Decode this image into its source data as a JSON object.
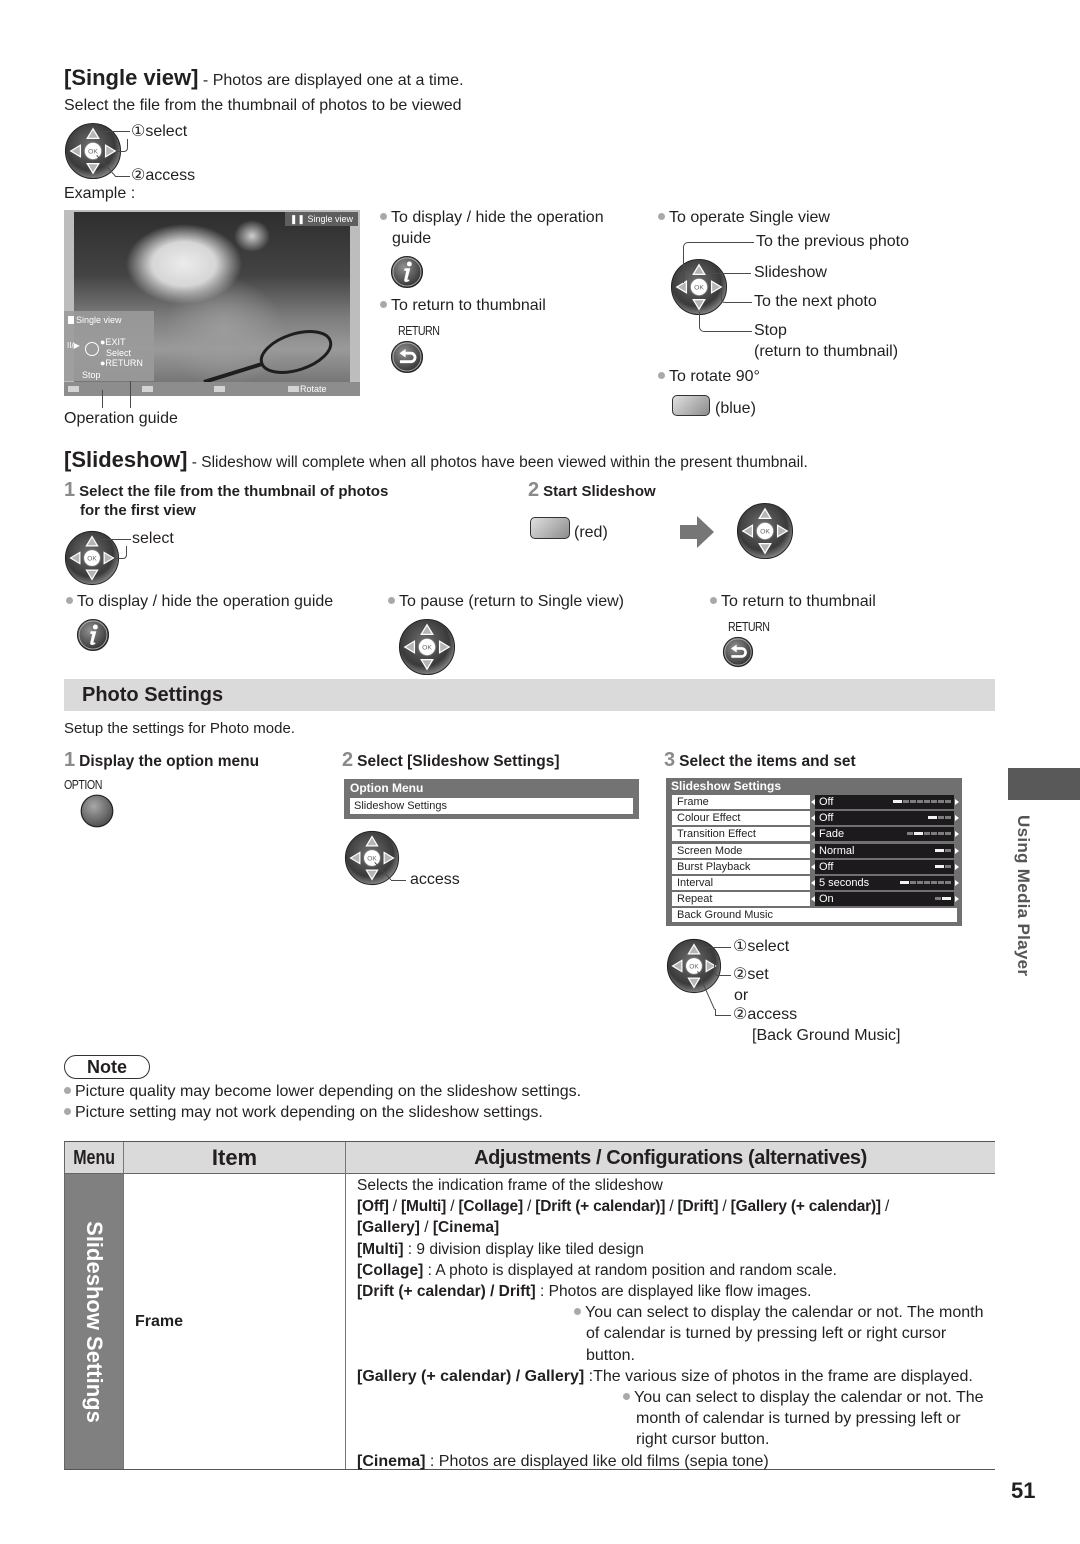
{
  "remote": {
    "ok_label": "OK"
  },
  "single_view": {
    "title": "[Single view]",
    "subtitle": " - Photos are displayed one at a time.",
    "instruction": "Select the file from the thumbnail of photos to be viewed",
    "select_label": "①select",
    "access_label": "②access",
    "example_label": "Example :",
    "screen": {
      "badge": "Single view",
      "guide_title": "Single view",
      "guide_play_pause": "II/▶",
      "guide_exit": "●EXIT",
      "guide_select": "Select",
      "guide_return": "●RETURN",
      "guide_stop": "Stop",
      "rotate": "Rotate"
    },
    "operation_guide_label": "Operation guide",
    "display_hide_line1": "To display / hide the operation",
    "display_hide_line2": "guide",
    "return_to_thumbnail": "To return to thumbnail",
    "return_button_caption": "RETURN",
    "operate": {
      "title": "To operate Single view",
      "previous": "To the previous photo",
      "slideshow": "Slideshow",
      "next": "To the next photo",
      "stop": "Stop",
      "stop_note": "(return to thumbnail)"
    },
    "rotate": {
      "title": "To rotate 90°",
      "button_caption": "(blue)"
    }
  },
  "slideshow": {
    "title": "[Slideshow]",
    "subtitle": " - Slideshow will complete when all photos have been viewed within the present thumbnail.",
    "step1": {
      "number": "1",
      "title_line1": "Select the file from the thumbnail of photos",
      "title_line2": "for the first view",
      "select_label": "select"
    },
    "step2": {
      "number": "2",
      "title": "Start Slideshow",
      "button_caption": "(red)"
    },
    "display_hide": "To display / hide the operation guide",
    "pause": "To pause (return to Single view)",
    "return_to_thumbnail": "To return to thumbnail",
    "return_button_caption": "RETURN"
  },
  "photo_settings": {
    "heading": "Photo Settings",
    "intro": "Setup the settings for Photo mode.",
    "step1": {
      "number": "1",
      "title": "Display the option menu",
      "button_caption": "OPTION"
    },
    "step2": {
      "number": "2",
      "title": "Select [Slideshow Settings]",
      "menu_title": "Option Menu",
      "menu_item": "Slideshow Settings",
      "access_label": "access"
    },
    "step3": {
      "number": "3",
      "title": "Select the items and set",
      "panel_title": "Slideshow Settings",
      "rows": [
        {
          "label": "Frame",
          "value": "Off",
          "options_count": 8,
          "selected_index": 0
        },
        {
          "label": "Colour Effect",
          "value": "Off",
          "options_count": 3,
          "selected_index": 0
        },
        {
          "label": "Transition Effect",
          "value": "Fade",
          "options_count": 6,
          "selected_index": 1
        },
        {
          "label": "Screen Mode",
          "value": "Normal",
          "options_count": 2,
          "selected_index": 0
        },
        {
          "label": "Burst Playback",
          "value": "Off",
          "options_count": 2,
          "selected_index": 0
        },
        {
          "label": "Interval",
          "value": "5 seconds",
          "options_count": 7,
          "selected_index": 0
        },
        {
          "label": "Repeat",
          "value": "On",
          "options_count": 2,
          "selected_index": 1
        },
        {
          "label": "Back Ground Music"
        }
      ],
      "select_label": "①select",
      "set_label": "②set",
      "or_label": "or",
      "access_label": "②access",
      "access_target": "[Back Ground Music]"
    }
  },
  "side_tab": {
    "label": "Using Media Player"
  },
  "note": {
    "title": "Note",
    "items": [
      "Picture quality may become lower depending on the slideshow settings.",
      "Picture setting may not work depending on the slideshow settings."
    ]
  },
  "table": {
    "headers": {
      "menu": "Menu",
      "item": "Item",
      "adjustments": "Adjustments / Configurations (alternatives)"
    },
    "menu_group": "Slideshow Settings",
    "rows": [
      {
        "item": "Frame",
        "intro": "Selects the indication frame of the slideshow",
        "separator": " / ",
        "options": [
          "[Off]",
          "[Multi]",
          "[Collage]",
          "[Drift (+ calendar)]",
          "[Drift]",
          "[Gallery (+ calendar)]",
          "[Gallery]",
          "[Cinema]"
        ],
        "descriptions": [
          {
            "term": "[Multi]",
            "text": " : 9 division display like tiled design"
          },
          {
            "term": "[Collage]",
            "text": " : A photo is displayed at random position and random scale."
          },
          {
            "term": "[Drift (+ calendar) / Drift]",
            "text": " :  Photos are displayed like flow images.",
            "note_lines": [
              "You can select to display the calendar or not. The month",
              "of calendar is turned by pressing left or right cursor",
              "button."
            ]
          },
          {
            "term": "[Gallery (+ calendar) / Gallery]",
            "text": " :The various size of photos in the frame are displayed.",
            "note_lines": [
              "You can select to display the calendar or not. The",
              "month of calendar is turned by pressing left or",
              "right cursor button."
            ]
          },
          {
            "term": "[Cinema]",
            "text": " : Photos are displayed like old films (sepia tone)"
          }
        ]
      }
    ]
  },
  "page_number": "51"
}
